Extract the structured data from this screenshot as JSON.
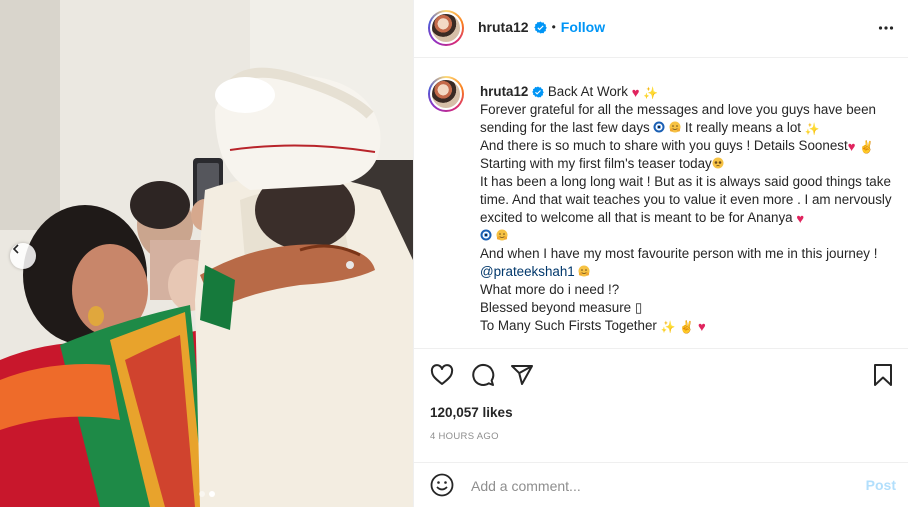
{
  "post": {
    "username": "hruta12",
    "follow_label": "Follow",
    "separator": "•",
    "caption": {
      "headline": "Back At Work",
      "lines": [
        "Forever grateful for all the messages and love you guys have been sending for the last few days",
        "It really means a lot",
        "And there is so much to share with you guys ! Details Soonest",
        "Starting with my first film's teaser today",
        "It has been a long long wait ! But as it is always said good things take time. And that wait teaches you to value it even more . I am nervously excited to welcome all that is meant to be for Ananya",
        "And when I have my most favourite person with me in this journey !",
        "@prateekshah1",
        "What more do i need !?",
        "Blessed beyond measure ▯",
        "To Many Such Firsts Together"
      ]
    },
    "likes": "120,057 likes",
    "timestamp": "4 HOURS AGO",
    "comment_placeholder": "Add a comment...",
    "post_button": "Post"
  },
  "icons": {
    "verified": "verified-badge-icon",
    "more": "more-options-icon",
    "like": "heart-icon",
    "comment": "comment-icon",
    "share": "share-icon",
    "save": "bookmark-icon",
    "emoji": "emoji-icon",
    "carousel_prev": "chevron-left-icon"
  },
  "colors": {
    "accent": "#0095f6",
    "post_disabled": "#b2dffc",
    "text": "#262626",
    "muted": "#8e8e8e",
    "heart": "#ed4956"
  },
  "carousel": {
    "slides": 2,
    "active": 1
  }
}
